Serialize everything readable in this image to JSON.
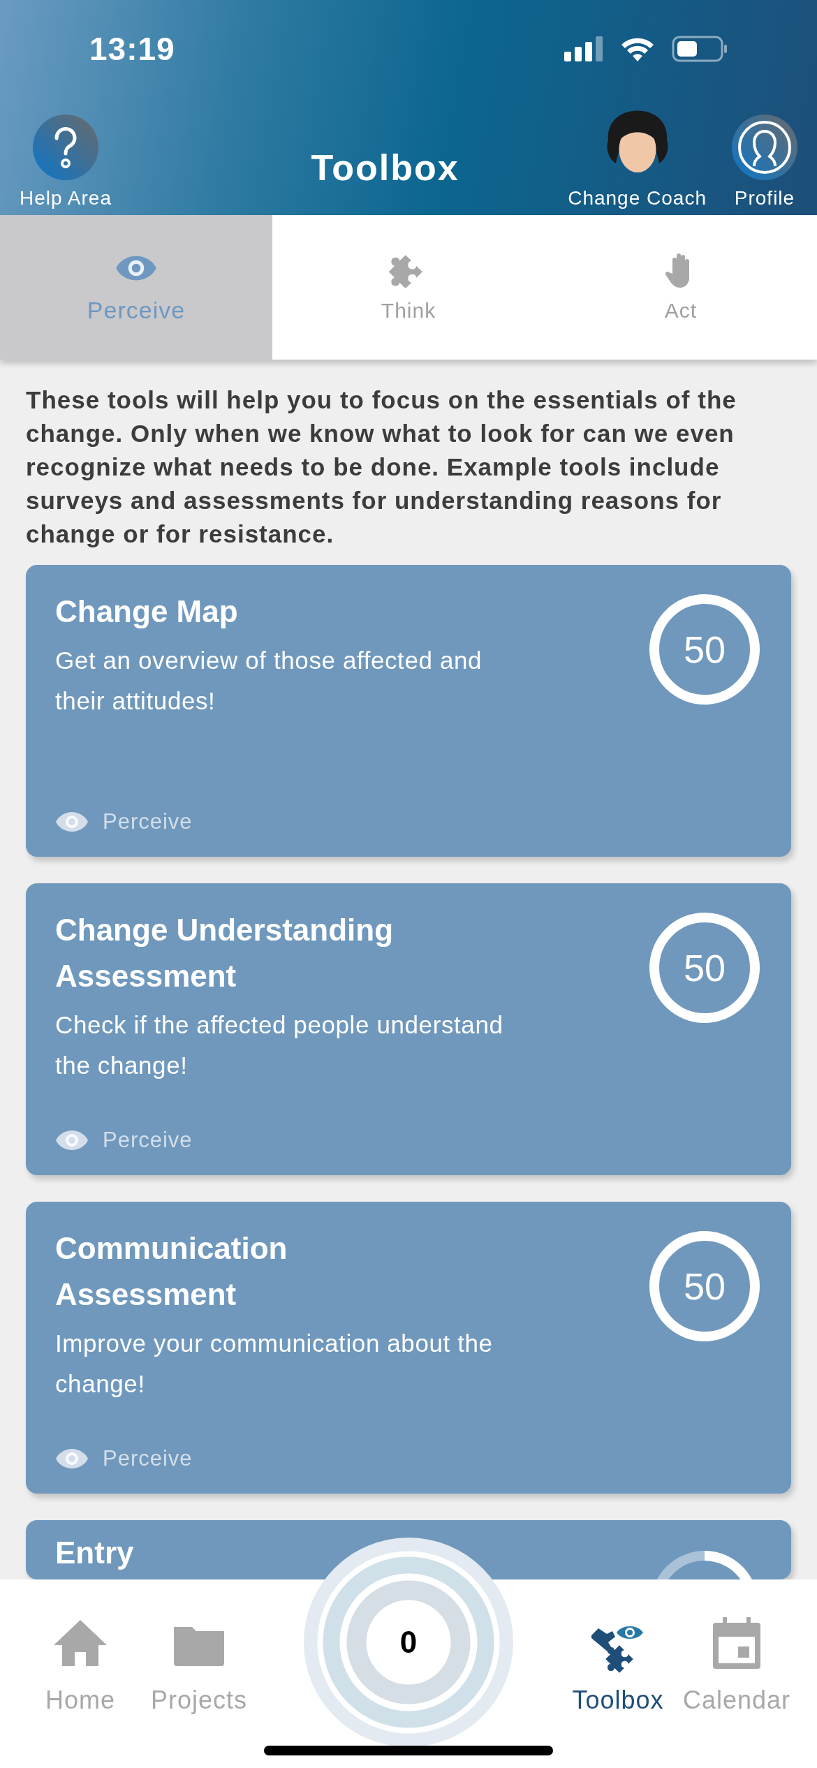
{
  "status_bar": {
    "time": "13:19"
  },
  "header": {
    "title": "Toolbox",
    "help_label": "Help Area",
    "coach_label": "Change Coach",
    "profile_label": "Profile"
  },
  "tabs": [
    {
      "label": "Perceive",
      "selected": true
    },
    {
      "label": "Think",
      "selected": false
    },
    {
      "label": "Act",
      "selected": false
    }
  ],
  "intro": "These tools will help you to focus on the essentials of the change. Only when we know what to look for can we even recognize what needs to be done. Example tools include surveys and assessments for understanding reasons for change or for resistance.",
  "cards": [
    {
      "title": "Change Map",
      "description": "Get an overview of those affected and their attitudes!",
      "score": "50",
      "tag": "Perceive"
    },
    {
      "title": "Change Understanding Assessment",
      "description": "Check if the affected people understand the change!",
      "score": "50",
      "tag": "Perceive"
    },
    {
      "title": "Communication Assessment",
      "description": "Improve your communication about the change!",
      "score": "50",
      "tag": "Perceive"
    },
    {
      "title": "Entry"
    }
  ],
  "bottom_nav": {
    "items": [
      {
        "label": "Home",
        "selected": false
      },
      {
        "label": "Projects",
        "selected": false
      },
      {
        "label": "Toolbox",
        "selected": true
      },
      {
        "label": "Calendar",
        "selected": false
      }
    ],
    "center_count": "0"
  }
}
